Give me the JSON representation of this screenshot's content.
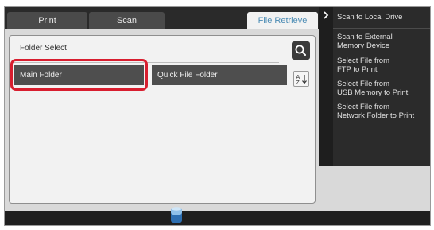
{
  "tabs": [
    {
      "label": "Print",
      "active": false
    },
    {
      "label": "Scan",
      "active": false
    },
    {
      "label": "File Retrieve",
      "active": true
    }
  ],
  "panel": {
    "title": "Folder Select",
    "search_icon": "search-icon",
    "sort_icon": "sort-az-icon"
  },
  "folders": {
    "main": "Main Folder",
    "quick": "Quick File Folder"
  },
  "drawer": {
    "toggle_icon": "chevron-right-icon",
    "items": [
      {
        "line1": "Scan to Local Drive",
        "line2": ""
      },
      {
        "line1": "Scan to External",
        "line2": "Memory Device"
      },
      {
        "line1": "Select File from",
        "line2": "FTP to Print"
      },
      {
        "line1": "Select File from",
        "line2": "USB Memory to Print"
      },
      {
        "line1": "Select File from",
        "line2": "Network Folder to Print"
      }
    ]
  },
  "status": {
    "icon": "storage-icon"
  },
  "colors": {
    "highlight": "#d81e2f",
    "active_tab_text": "#4a8bb4",
    "folder_button": "#4e4e4e",
    "drawer_bg": "#2b2b2b"
  }
}
